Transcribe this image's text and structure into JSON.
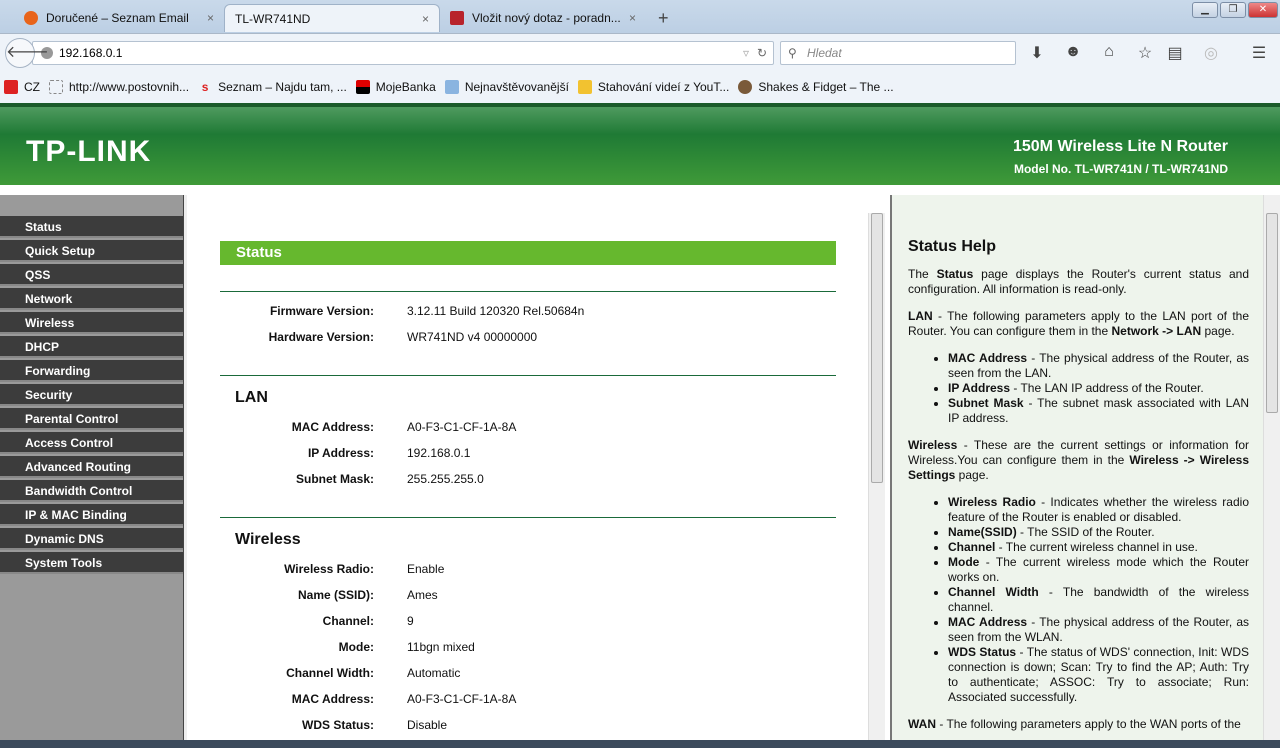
{
  "browser": {
    "tabs": [
      {
        "label": "Doručené – Seznam Email",
        "active": false
      },
      {
        "label": "TL-WR741ND",
        "active": true
      },
      {
        "label": "Vložit nový dotaz - poradn...",
        "active": false
      }
    ],
    "new_tab": "+",
    "close": "×",
    "url": "192.168.0.1",
    "search_placeholder": "Hledat",
    "bookmarks": [
      "CZ",
      "http://www.postovnih...",
      "Seznam – Najdu tam, ...",
      "MojeBanka",
      "Nejnavštěvovanější",
      "Stahování videí z YouT...",
      "Shakes & Fidget – The ..."
    ]
  },
  "header": {
    "logo": "TP-LINK",
    "product": "150M Wireless Lite N Router",
    "model": "Model No. TL-WR741N / TL-WR741ND"
  },
  "sidebar": {
    "items": [
      "Status",
      "Quick Setup",
      "QSS",
      "Network",
      "Wireless",
      "DHCP",
      "Forwarding",
      "Security",
      "Parental Control",
      "Access Control",
      "Advanced Routing",
      "Bandwidth Control",
      "IP & MAC Binding",
      "Dynamic DNS",
      "System Tools"
    ]
  },
  "main": {
    "title": "Status",
    "firmware": {
      "label": "Firmware Version:",
      "value": "3.12.11 Build 120320 Rel.50684n"
    },
    "hardware": {
      "label": "Hardware Version:",
      "value": "WR741ND v4 00000000"
    },
    "lan": {
      "title": "LAN",
      "rows": [
        {
          "label": "MAC Address:",
          "value": "A0-F3-C1-CF-1A-8A"
        },
        {
          "label": "IP Address:",
          "value": "192.168.0.1"
        },
        {
          "label": "Subnet Mask:",
          "value": "255.255.255.0"
        }
      ]
    },
    "wireless": {
      "title": "Wireless",
      "rows": [
        {
          "label": "Wireless Radio:",
          "value": "Enable"
        },
        {
          "label": "Name (SSID):",
          "value": "Ames"
        },
        {
          "label": "Channel:",
          "value": "9"
        },
        {
          "label": "Mode:",
          "value": "11bgn mixed"
        },
        {
          "label": "Channel Width:",
          "value": "Automatic"
        },
        {
          "label": "MAC Address:",
          "value": "A0-F3-C1-CF-1A-8A"
        },
        {
          "label": "WDS Status:",
          "value": "Disable"
        }
      ]
    }
  },
  "help": {
    "title": "Status Help",
    "intro": {
      "a": "The ",
      "b": "Status",
      "c": " page displays the Router's current status and configuration. All information is read-only."
    },
    "lan": {
      "b": "LAN",
      "t": " - The following parameters apply to the LAN port of the Router. You can configure them in the ",
      "b2": "Network -> LAN",
      "t2": " page."
    },
    "lan_items": [
      {
        "b": "MAC Address",
        "t": " - The physical address of the Router, as seen from the LAN."
      },
      {
        "b": "IP Address",
        "t": " - The LAN IP address of the Router."
      },
      {
        "b": "Subnet Mask",
        "t": " - The subnet mask associated with LAN IP address."
      }
    ],
    "wireless": {
      "b": "Wireless",
      "t": " - These are the current settings or information for Wireless.You can configure them in the ",
      "b2": "Wireless -> Wireless Settings",
      "t2": " page."
    },
    "wireless_items": [
      {
        "b": "Wireless Radio",
        "t": " - Indicates whether the wireless radio feature of the Router is enabled or disabled."
      },
      {
        "b": "Name(SSID)",
        "t": " - The SSID of the Router."
      },
      {
        "b": "Channel",
        "t": " - The current wireless channel in use."
      },
      {
        "b": "Mode",
        "t": " - The current wireless mode which the Router works on."
      },
      {
        "b": "Channel Width",
        "t": " - The bandwidth of the wireless channel."
      },
      {
        "b": "MAC Address",
        "t": " - The physical address of the Router, as seen from the WLAN."
      },
      {
        "b": "WDS Status",
        "t": " - The status of WDS' connection, Init: WDS connection is down; Scan: Try to find the AP; Auth: Try to authenticate; ASSOC: Try to associate; Run: Associated successfully."
      }
    ],
    "wan": {
      "b": "WAN",
      "t": " - The following parameters apply to the WAN ports of the"
    }
  },
  "colors": {
    "brand_green": "#1f7a35",
    "title_bar": "#66b82e",
    "menu": "#3c3c3c"
  }
}
